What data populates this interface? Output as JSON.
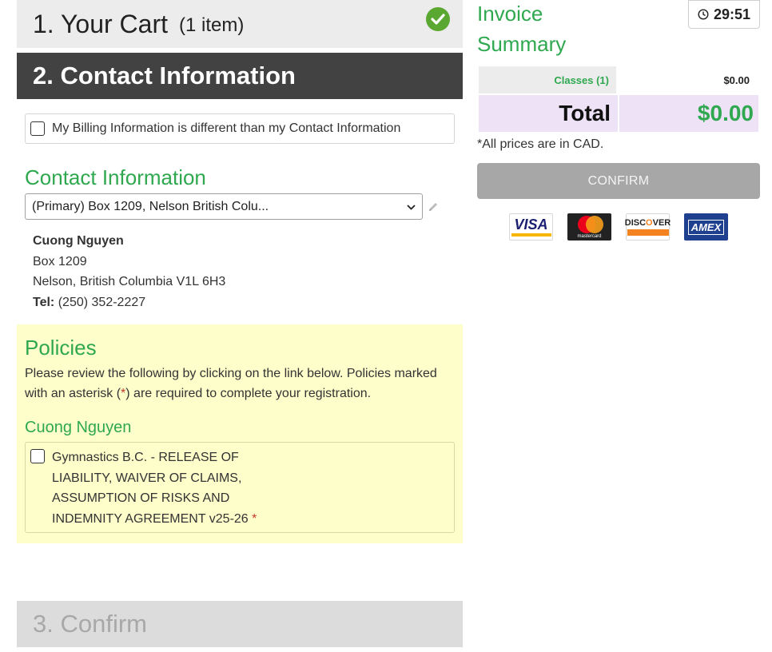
{
  "cart": {
    "title": "1. Your Cart",
    "count": "(1 item)"
  },
  "contact_step": {
    "title": "2. Contact Information"
  },
  "billing": {
    "label": "My Billing Information is different than my Contact Information"
  },
  "contact": {
    "heading": "Contact Information",
    "selected_address": "(Primary) Box 1209, Nelson British Colu...",
    "name": "Cuong Nguyen",
    "line1": "Box 1209",
    "line2": "Nelson, British Columbia V1L 6H3",
    "tel_label": "Tel:",
    "tel": "(250) 352-2227"
  },
  "policies": {
    "heading": "Policies",
    "desc_a": "Please review the following by clicking on the link below. Policies marked with an asterisk (",
    "asterisk": "*",
    "desc_b": ") are required to complete your registration.",
    "participant": "Cuong Nguyen",
    "item_text": "Gymnastics B.C. - RELEASE OF LIABILITY, WAIVER OF CLAIMS, ASSUMPTION OF RISKS AND INDEMNITY AGREEMENT v25-26",
    "item_required": "*"
  },
  "confirm_step": {
    "title": "3. Confirm"
  },
  "invoice": {
    "title": "Invoice Summary",
    "timer": "29:51",
    "classes_label": "Classes (1)",
    "classes_value": "$0.00",
    "total_label": "Total",
    "total_value": "$0.00",
    "note": "*All prices are in CAD.",
    "confirm_label": "CONFIRM"
  },
  "cards": {
    "visa": "VISA",
    "mastercard": "mastercard",
    "discover_a": "DISC",
    "discover_o": "O",
    "discover_b": "VER",
    "amex": "AMEX"
  },
  "colors": {
    "green": "#2fa84f",
    "dark_header": "#424242",
    "policies_bg": "#fefecb",
    "total_bg": "#ede2f6"
  }
}
